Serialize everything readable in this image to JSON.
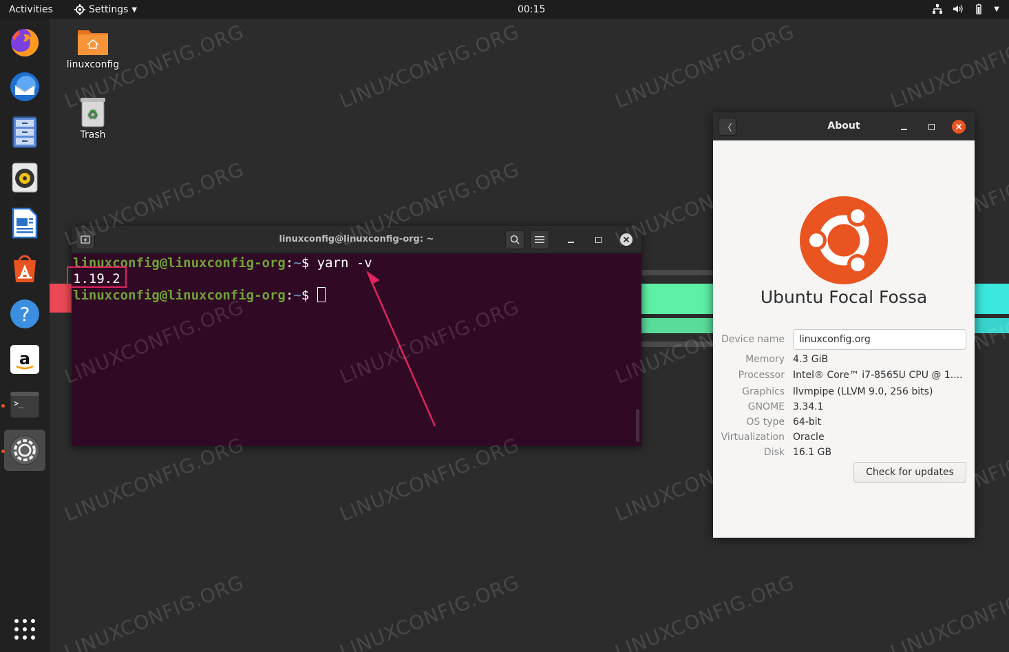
{
  "topbar": {
    "activities": "Activities",
    "app_menu": "Settings",
    "clock": "00:15"
  },
  "dock": [
    {
      "name": "firefox"
    },
    {
      "name": "thunderbird"
    },
    {
      "name": "files"
    },
    {
      "name": "rhythmbox"
    },
    {
      "name": "libreoffice-writer"
    },
    {
      "name": "ubuntu-software"
    },
    {
      "name": "help"
    },
    {
      "name": "amazon"
    },
    {
      "name": "terminal"
    },
    {
      "name": "settings"
    },
    {
      "name": "show-applications"
    }
  ],
  "desktop": {
    "home_label": "linuxconfig",
    "trash_label": "Trash"
  },
  "watermark": "LINUXCONFIG.ORG",
  "terminal": {
    "title": "linuxconfig@linuxconfig-org: ~",
    "lines": [
      {
        "user": "linuxconfig@linuxconfig-org",
        "sep": ":",
        "path": "~",
        "sym": "$ ",
        "cmd": "yarn -v"
      },
      {
        "output": "1.19.2"
      },
      {
        "user": "linuxconfig@linuxconfig-org",
        "sep": ":",
        "path": "~",
        "sym": "$ ",
        "cmd": ""
      }
    ]
  },
  "about": {
    "title": "About",
    "os_name": "Ubuntu Focal Fossa",
    "device_name_label": "Device name",
    "device_name_value": "linuxconfig.org",
    "rows": [
      {
        "key": "Memory",
        "value": "4.3 GiB"
      },
      {
        "key": "Processor",
        "value": "Intel® Core™ i7-8565U CPU @ 1...."
      },
      {
        "key": "Graphics",
        "value": "llvmpipe (LLVM 9.0, 256 bits)"
      },
      {
        "key": "GNOME",
        "value": "3.34.1"
      },
      {
        "key": "OS type",
        "value": "64-bit"
      },
      {
        "key": "Virtualization",
        "value": "Oracle"
      },
      {
        "key": "Disk",
        "value": "16.1 GB"
      }
    ],
    "check_updates": "Check for updates"
  },
  "colors": {
    "terminal_bg": "#300a24",
    "prompt_user": "#6ea336",
    "prompt_path": "#729fcf",
    "ubuntu_orange": "#e95420",
    "highlight": "#e0245e"
  }
}
